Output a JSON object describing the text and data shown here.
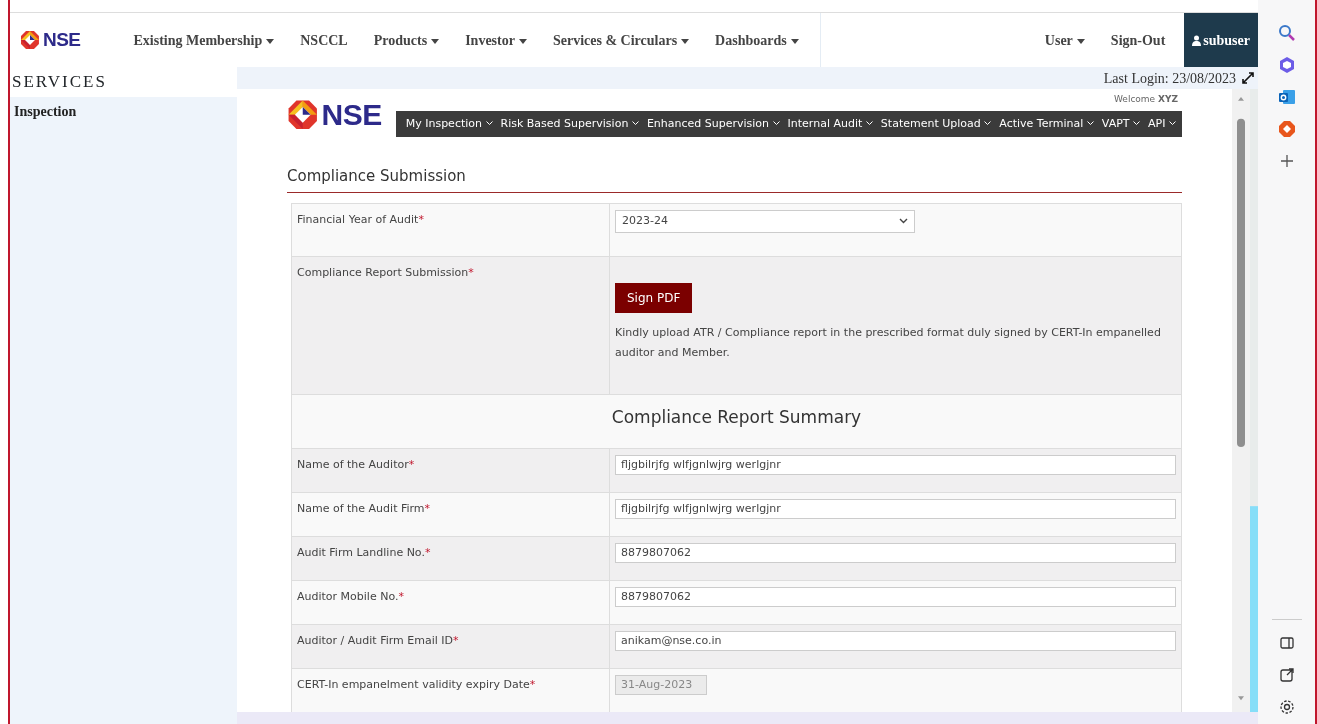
{
  "top_nav": {
    "logo": "NSE",
    "items": [
      {
        "label": "Existing Membership",
        "dropdown": true
      },
      {
        "label": "NSCCL",
        "dropdown": false
      },
      {
        "label": "Products",
        "dropdown": true
      },
      {
        "label": "Investor",
        "dropdown": true
      },
      {
        "label": "Services & Circulars",
        "dropdown": true
      },
      {
        "label": "Dashboards",
        "dropdown": true
      }
    ],
    "right_items": [
      {
        "label": "User",
        "dropdown": true
      },
      {
        "label": "Sign-Out",
        "dropdown": false
      }
    ],
    "user": "subuser"
  },
  "sidebar": {
    "title": "SERVICES",
    "items": [
      {
        "label": "Inspection",
        "selected": true
      }
    ]
  },
  "last_login": "Last Login: 23/08/2023",
  "frame": {
    "logo": "NSE",
    "welcome": "Welcome",
    "welcome_name": "XYZ",
    "menu": [
      "My Inspection",
      "Risk Based Supervision",
      "Enhanced Supervision",
      "Internal Audit",
      "Statement Upload",
      "Active Terminal",
      "VAPT",
      "API"
    ],
    "title": "Compliance Submission",
    "rows": [
      {
        "kind": "select",
        "label": "Financial Year of Audit",
        "required_mark": "*",
        "value": "2023-24"
      },
      {
        "kind": "upload",
        "label": "Compliance Report Submission",
        "required_mark": "*",
        "button": "Sign PDF",
        "note": "Kindly upload ATR / Compliance report in the prescribed format duly signed by CERT-In empanelled auditor and Member."
      },
      {
        "kind": "heading",
        "label": "Compliance Report Summary"
      },
      {
        "kind": "text",
        "label": "Name of the Auditor",
        "required_mark": "*",
        "value": "fljgbilrjfg wlfjgnlwjrg werlgjnr"
      },
      {
        "kind": "text",
        "label": "Name of the Audit Firm",
        "required_mark": "*",
        "value": "fljgbilrjfg wlfjgnlwjrg werlgjnr"
      },
      {
        "kind": "text",
        "label": "Audit Firm Landline No.",
        "required_mark": "*",
        "value": "8879807062"
      },
      {
        "kind": "text",
        "label": "Auditor Mobile No.",
        "required_mark": "*",
        "value": "8879807062"
      },
      {
        "kind": "text",
        "label": "Auditor / Audit Firm Email ID",
        "required_mark": "*",
        "value": "anikam@nse.co.in"
      },
      {
        "kind": "date",
        "label": "CERT-In empanelment validity expiry Date",
        "required_mark": "*",
        "value": "31-Aug-2023",
        "disabled": true
      }
    ]
  }
}
